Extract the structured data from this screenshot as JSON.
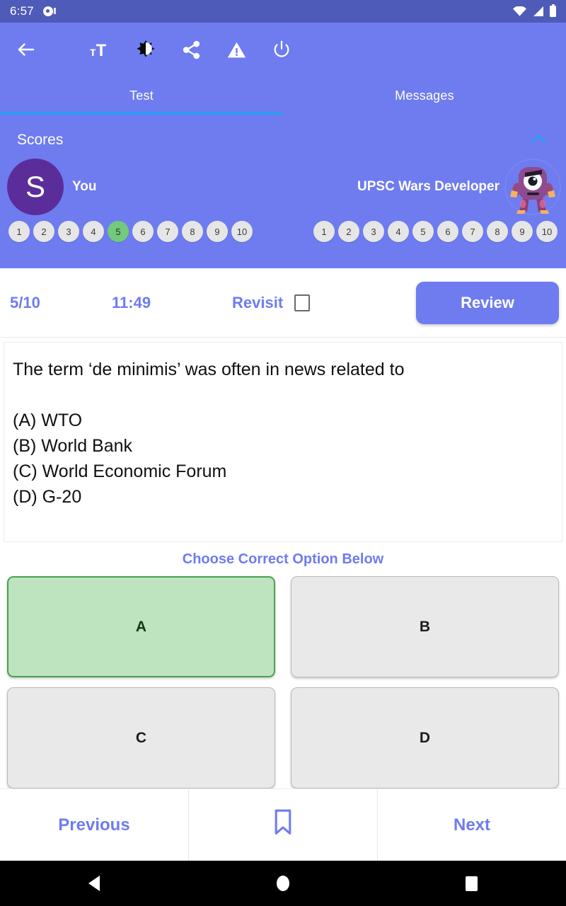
{
  "status_bar": {
    "time": "6:57",
    "icons": [
      "record-dot-icon",
      "wifi-icon",
      "cellular-signal-icon",
      "battery-icon"
    ],
    "background": "#4e5bb8"
  },
  "app_bar": {
    "background": "#6e7cef",
    "actions": [
      {
        "name": "back-arrow-icon",
        "label": "Back"
      },
      {
        "name": "text-size-icon",
        "label": "Text size"
      },
      {
        "name": "brightness-contrast-icon",
        "label": "Brightness"
      },
      {
        "name": "share-icon",
        "label": "Share"
      },
      {
        "name": "report-warning-icon",
        "label": "Report"
      },
      {
        "name": "power-icon",
        "label": "Quit"
      }
    ]
  },
  "tabs": {
    "items": [
      {
        "label": "Test",
        "active": true
      },
      {
        "label": "Messages",
        "active": false
      }
    ],
    "indicator_color": "#2f9bf5"
  },
  "scores": {
    "title": "Scores",
    "collapse_icon": "chevron-up-icon",
    "players": [
      {
        "name": "You",
        "avatar_initial": "S",
        "avatar_color": "#5b2d9b",
        "dots": [
          "1",
          "2",
          "3",
          "4",
          "5",
          "6",
          "7",
          "8",
          "9",
          "10"
        ],
        "correct_index": 4
      },
      {
        "name": "UPSC Wars Developer",
        "avatar_initial": "",
        "avatar_color": "#8b4a93",
        "dots": [
          "1",
          "2",
          "3",
          "4",
          "5",
          "6",
          "7",
          "8",
          "9",
          "10"
        ],
        "correct_index": -1
      }
    ],
    "dot_color": "#e6e6e6",
    "correct_color": "#73c97c"
  },
  "meta": {
    "question_progress": "5/10",
    "timer": "11:49",
    "revisit_label": "Revisit",
    "revisit_checked": false,
    "review_label": "Review"
  },
  "question": {
    "text": "The term ‘de minimis’ was often in news related to",
    "options_text": "(A) WTO\n(B) World Bank\n(C) World Economic Forum\n(D) G-20"
  },
  "choose_label": "Choose Correct Option Below",
  "options": [
    {
      "label": "A",
      "selected": true
    },
    {
      "label": "B",
      "selected": false
    },
    {
      "label": "C",
      "selected": false
    },
    {
      "label": "D",
      "selected": false
    }
  ],
  "bottom_nav": {
    "previous_label": "Previous",
    "bookmark_icon": "bookmark-icon",
    "next_label": "Next"
  },
  "android_nav": {
    "back": "android-back-icon",
    "home": "android-home-icon",
    "recents": "android-recents-icon"
  },
  "colors": {
    "primary": "#6e7cef",
    "status_bar": "#4e5bb8",
    "accent_blue": "#2f9bf5",
    "correct_green": "#73c97c",
    "option_selected_bg": "#bee3bf",
    "option_selected_border": "#4aa14f"
  }
}
